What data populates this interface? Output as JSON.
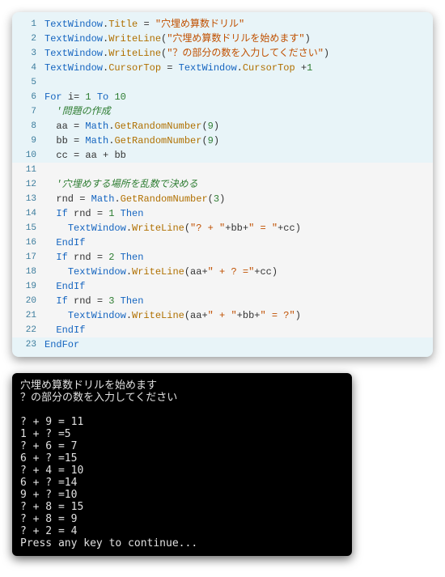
{
  "code": [
    {
      "n": 1,
      "hl": false,
      "tokens": [
        {
          "t": "TextWindow",
          "c": "tok-obj"
        },
        {
          "t": ".",
          "c": "tok-dot"
        },
        {
          "t": "Title",
          "c": "tok-prop"
        },
        {
          "t": " ",
          "c": ""
        },
        {
          "t": "=",
          "c": "tok-op"
        },
        {
          "t": " ",
          "c": ""
        },
        {
          "t": "\"穴埋め算数ドリル\"",
          "c": "tok-str"
        }
      ]
    },
    {
      "n": 2,
      "hl": false,
      "tokens": [
        {
          "t": "TextWindow",
          "c": "tok-obj"
        },
        {
          "t": ".",
          "c": "tok-dot"
        },
        {
          "t": "WriteLine",
          "c": "tok-prop"
        },
        {
          "t": "(",
          "c": "tok-op"
        },
        {
          "t": "\"穴埋め算数ドリルを始めます\"",
          "c": "tok-str"
        },
        {
          "t": ")",
          "c": "tok-op"
        }
      ]
    },
    {
      "n": 3,
      "hl": false,
      "tokens": [
        {
          "t": "TextWindow",
          "c": "tok-obj"
        },
        {
          "t": ".",
          "c": "tok-dot"
        },
        {
          "t": "WriteLine",
          "c": "tok-prop"
        },
        {
          "t": "(",
          "c": "tok-op"
        },
        {
          "t": "\"？の部分の数を入力してください\"",
          "c": "tok-str"
        },
        {
          "t": ")",
          "c": "tok-op"
        }
      ]
    },
    {
      "n": 4,
      "hl": false,
      "tokens": [
        {
          "t": "TextWindow",
          "c": "tok-obj"
        },
        {
          "t": ".",
          "c": "tok-dot"
        },
        {
          "t": "CursorTop",
          "c": "tok-prop"
        },
        {
          "t": " ",
          "c": ""
        },
        {
          "t": "=",
          "c": "tok-op"
        },
        {
          "t": " ",
          "c": ""
        },
        {
          "t": "TextWindow",
          "c": "tok-obj"
        },
        {
          "t": ".",
          "c": "tok-dot"
        },
        {
          "t": "CursorTop",
          "c": "tok-prop"
        },
        {
          "t": " ",
          "c": ""
        },
        {
          "t": "+",
          "c": "tok-op"
        },
        {
          "t": "1",
          "c": "tok-num"
        }
      ]
    },
    {
      "n": 5,
      "hl": false,
      "tokens": []
    },
    {
      "n": 6,
      "hl": false,
      "tokens": [
        {
          "t": "For",
          "c": "tok-kw"
        },
        {
          "t": " ",
          "c": ""
        },
        {
          "t": "i",
          "c": "tok-var"
        },
        {
          "t": "=",
          "c": "tok-op"
        },
        {
          "t": " ",
          "c": ""
        },
        {
          "t": "1",
          "c": "tok-num"
        },
        {
          "t": " ",
          "c": ""
        },
        {
          "t": "To",
          "c": "tok-kw"
        },
        {
          "t": " ",
          "c": ""
        },
        {
          "t": "10",
          "c": "tok-num"
        }
      ]
    },
    {
      "n": 7,
      "hl": false,
      "tokens": [
        {
          "t": "  ",
          "c": ""
        },
        {
          "t": "'問題の作成",
          "c": "tok-com"
        }
      ]
    },
    {
      "n": 8,
      "hl": false,
      "tokens": [
        {
          "t": "  ",
          "c": ""
        },
        {
          "t": "aa",
          "c": "tok-var"
        },
        {
          "t": " ",
          "c": ""
        },
        {
          "t": "=",
          "c": "tok-op"
        },
        {
          "t": " ",
          "c": ""
        },
        {
          "t": "Math",
          "c": "tok-obj"
        },
        {
          "t": ".",
          "c": "tok-dot"
        },
        {
          "t": "GetRandomNumber",
          "c": "tok-prop"
        },
        {
          "t": "(",
          "c": "tok-op"
        },
        {
          "t": "9",
          "c": "tok-num"
        },
        {
          "t": ")",
          "c": "tok-op"
        }
      ]
    },
    {
      "n": 9,
      "hl": false,
      "tokens": [
        {
          "t": "  ",
          "c": ""
        },
        {
          "t": "bb",
          "c": "tok-var"
        },
        {
          "t": " ",
          "c": ""
        },
        {
          "t": "=",
          "c": "tok-op"
        },
        {
          "t": " ",
          "c": ""
        },
        {
          "t": "Math",
          "c": "tok-obj"
        },
        {
          "t": ".",
          "c": "tok-dot"
        },
        {
          "t": "GetRandomNumber",
          "c": "tok-prop"
        },
        {
          "t": "(",
          "c": "tok-op"
        },
        {
          "t": "9",
          "c": "tok-num"
        },
        {
          "t": ")",
          "c": "tok-op"
        }
      ]
    },
    {
      "n": 10,
      "hl": false,
      "tokens": [
        {
          "t": "  ",
          "c": ""
        },
        {
          "t": "cc",
          "c": "tok-var"
        },
        {
          "t": " ",
          "c": ""
        },
        {
          "t": "=",
          "c": "tok-op"
        },
        {
          "t": " ",
          "c": ""
        },
        {
          "t": "aa",
          "c": "tok-var"
        },
        {
          "t": " ",
          "c": ""
        },
        {
          "t": "+",
          "c": "tok-op"
        },
        {
          "t": " ",
          "c": ""
        },
        {
          "t": "bb",
          "c": "tok-var"
        }
      ]
    },
    {
      "n": 11,
      "hl": true,
      "tokens": []
    },
    {
      "n": 12,
      "hl": true,
      "tokens": [
        {
          "t": "  ",
          "c": ""
        },
        {
          "t": "'穴埋めする場所を乱数で決める",
          "c": "tok-com"
        }
      ]
    },
    {
      "n": 13,
      "hl": true,
      "tokens": [
        {
          "t": "  ",
          "c": ""
        },
        {
          "t": "rnd",
          "c": "tok-var"
        },
        {
          "t": " ",
          "c": ""
        },
        {
          "t": "=",
          "c": "tok-op"
        },
        {
          "t": " ",
          "c": ""
        },
        {
          "t": "Math",
          "c": "tok-obj"
        },
        {
          "t": ".",
          "c": "tok-dot"
        },
        {
          "t": "GetRandomNumber",
          "c": "tok-prop"
        },
        {
          "t": "(",
          "c": "tok-op"
        },
        {
          "t": "3",
          "c": "tok-num"
        },
        {
          "t": ")",
          "c": "tok-op"
        }
      ]
    },
    {
      "n": 14,
      "hl": true,
      "tokens": [
        {
          "t": "  ",
          "c": ""
        },
        {
          "t": "If",
          "c": "tok-kw"
        },
        {
          "t": " ",
          "c": ""
        },
        {
          "t": "rnd",
          "c": "tok-var"
        },
        {
          "t": " ",
          "c": ""
        },
        {
          "t": "=",
          "c": "tok-op"
        },
        {
          "t": " ",
          "c": ""
        },
        {
          "t": "1",
          "c": "tok-num"
        },
        {
          "t": " ",
          "c": ""
        },
        {
          "t": "Then",
          "c": "tok-kw"
        }
      ]
    },
    {
      "n": 15,
      "hl": true,
      "tokens": [
        {
          "t": "    ",
          "c": ""
        },
        {
          "t": "TextWindow",
          "c": "tok-obj"
        },
        {
          "t": ".",
          "c": "tok-dot"
        },
        {
          "t": "WriteLine",
          "c": "tok-prop"
        },
        {
          "t": "(",
          "c": "tok-op"
        },
        {
          "t": "\"? + \"",
          "c": "tok-str"
        },
        {
          "t": "+",
          "c": "tok-op"
        },
        {
          "t": "bb",
          "c": "tok-var"
        },
        {
          "t": "+",
          "c": "tok-op"
        },
        {
          "t": "\" = \"",
          "c": "tok-str"
        },
        {
          "t": "+",
          "c": "tok-op"
        },
        {
          "t": "cc",
          "c": "tok-var"
        },
        {
          "t": ")",
          "c": "tok-op"
        }
      ]
    },
    {
      "n": 16,
      "hl": true,
      "tokens": [
        {
          "t": "  ",
          "c": ""
        },
        {
          "t": "EndIf",
          "c": "tok-kw"
        }
      ]
    },
    {
      "n": 17,
      "hl": true,
      "tokens": [
        {
          "t": "  ",
          "c": ""
        },
        {
          "t": "If",
          "c": "tok-kw"
        },
        {
          "t": " ",
          "c": ""
        },
        {
          "t": "rnd",
          "c": "tok-var"
        },
        {
          "t": " ",
          "c": ""
        },
        {
          "t": "=",
          "c": "tok-op"
        },
        {
          "t": " ",
          "c": ""
        },
        {
          "t": "2",
          "c": "tok-num"
        },
        {
          "t": " ",
          "c": ""
        },
        {
          "t": "Then",
          "c": "tok-kw"
        }
      ]
    },
    {
      "n": 18,
      "hl": true,
      "tokens": [
        {
          "t": "    ",
          "c": ""
        },
        {
          "t": "TextWindow",
          "c": "tok-obj"
        },
        {
          "t": ".",
          "c": "tok-dot"
        },
        {
          "t": "WriteLine",
          "c": "tok-prop"
        },
        {
          "t": "(",
          "c": "tok-op"
        },
        {
          "t": "aa",
          "c": "tok-var"
        },
        {
          "t": "+",
          "c": "tok-op"
        },
        {
          "t": "\" + ? =\"",
          "c": "tok-str"
        },
        {
          "t": "+",
          "c": "tok-op"
        },
        {
          "t": "cc",
          "c": "tok-var"
        },
        {
          "t": ")",
          "c": "tok-op"
        }
      ]
    },
    {
      "n": 19,
      "hl": true,
      "tokens": [
        {
          "t": "  ",
          "c": ""
        },
        {
          "t": "EndIf",
          "c": "tok-kw"
        }
      ]
    },
    {
      "n": 20,
      "hl": true,
      "tokens": [
        {
          "t": "  ",
          "c": ""
        },
        {
          "t": "If",
          "c": "tok-kw"
        },
        {
          "t": " ",
          "c": ""
        },
        {
          "t": "rnd",
          "c": "tok-var"
        },
        {
          "t": " ",
          "c": ""
        },
        {
          "t": "=",
          "c": "tok-op"
        },
        {
          "t": " ",
          "c": ""
        },
        {
          "t": "3",
          "c": "tok-num"
        },
        {
          "t": " ",
          "c": ""
        },
        {
          "t": "Then",
          "c": "tok-kw"
        }
      ]
    },
    {
      "n": 21,
      "hl": true,
      "tokens": [
        {
          "t": "    ",
          "c": ""
        },
        {
          "t": "TextWindow",
          "c": "tok-obj"
        },
        {
          "t": ".",
          "c": "tok-dot"
        },
        {
          "t": "WriteLine",
          "c": "tok-prop"
        },
        {
          "t": "(",
          "c": "tok-op"
        },
        {
          "t": "aa",
          "c": "tok-var"
        },
        {
          "t": "+",
          "c": "tok-op"
        },
        {
          "t": "\" + \"",
          "c": "tok-str"
        },
        {
          "t": "+",
          "c": "tok-op"
        },
        {
          "t": "bb",
          "c": "tok-var"
        },
        {
          "t": "+",
          "c": "tok-op"
        },
        {
          "t": "\" = ?\"",
          "c": "tok-str"
        },
        {
          "t": ")",
          "c": "tok-op"
        }
      ]
    },
    {
      "n": 22,
      "hl": true,
      "tokens": [
        {
          "t": "  ",
          "c": ""
        },
        {
          "t": "EndIf",
          "c": "tok-kw"
        }
      ]
    },
    {
      "n": 23,
      "hl": false,
      "tokens": [
        {
          "t": "EndFor",
          "c": "tok-kw"
        }
      ]
    }
  ],
  "console": [
    "穴埋め算数ドリルを始めます",
    "？の部分の数を入力してください",
    "",
    "? + 9 = 11",
    "1 + ? =5",
    "? + 6 = 7",
    "6 + ? =15",
    "? + 4 = 10",
    "6 + ? =14",
    "9 + ? =10",
    "? + 8 = 15",
    "? + 8 = 9",
    "? + 2 = 4",
    "Press any key to continue..."
  ]
}
